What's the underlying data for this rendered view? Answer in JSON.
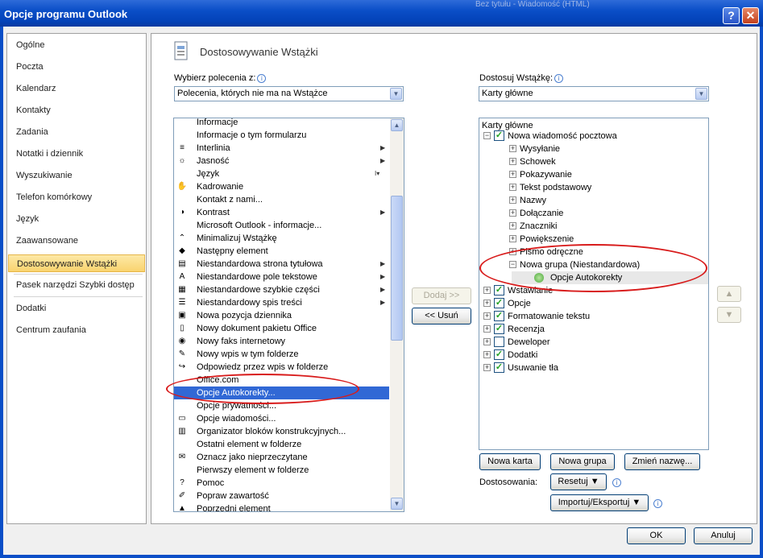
{
  "window": {
    "title": "Opcje programu Outlook",
    "background_title": "Bez tytułu - Wiadomość (HTML)",
    "help_label": "?",
    "close_label": "✕"
  },
  "nav": {
    "items": [
      {
        "label": "Ogólne"
      },
      {
        "label": "Poczta"
      },
      {
        "label": "Kalendarz"
      },
      {
        "label": "Kontakty"
      },
      {
        "label": "Zadania"
      },
      {
        "label": "Notatki i dziennik"
      },
      {
        "label": "Wyszukiwanie"
      },
      {
        "label": "Telefon komórkowy"
      },
      {
        "label": "Język"
      },
      {
        "label": "Zaawansowane"
      },
      {
        "label": "Dostosowywanie Wstążki",
        "selected": true
      },
      {
        "label": "Pasek narzędzi Szybki dostęp"
      },
      {
        "label": "Dodatki"
      },
      {
        "label": "Centrum zaufania"
      }
    ]
  },
  "page": {
    "heading": "Dostosowywanie Wstążki",
    "choose_label": "Wybierz polecenia z:",
    "choose_value": "Polecenia, których nie ma na Wstążce",
    "customize_label": "Dostosuj Wstążkę:",
    "customize_value": "Karty główne",
    "info_glyph": "i"
  },
  "commands": [
    {
      "label": "Informacje",
      "icon": ""
    },
    {
      "label": "Informacje o tym formularzu",
      "icon": ""
    },
    {
      "label": "Interlinia",
      "icon": "line-spacing-icon",
      "glyph": "≡",
      "submenu": true
    },
    {
      "label": "Jasność",
      "icon": "brightness-icon",
      "glyph": "☼",
      "submenu": true
    },
    {
      "label": "Język",
      "icon": "",
      "split": true
    },
    {
      "label": "Kadrowanie",
      "icon": "hand-icon",
      "glyph": "✋"
    },
    {
      "label": "Kontakt z nami...",
      "icon": ""
    },
    {
      "label": "Kontrast",
      "icon": "contrast-icon",
      "glyph": "◑",
      "submenu": true
    },
    {
      "label": "Microsoft Outlook - informacje...",
      "icon": ""
    },
    {
      "label": "Minimalizuj Wstążkę",
      "icon": "minimize-ribbon-icon",
      "glyph": "⌃"
    },
    {
      "label": "Następny element",
      "icon": "next-item-icon",
      "glyph": "◆"
    },
    {
      "label": "Niestandardowa strona tytułowa",
      "icon": "cover-page-icon",
      "glyph": "▤",
      "submenu": true
    },
    {
      "label": "Niestandardowe pole tekstowe",
      "icon": "text-box-icon",
      "glyph": "A",
      "submenu": true
    },
    {
      "label": "Niestandardowe szybkie części",
      "icon": "quick-parts-icon",
      "glyph": "▦",
      "submenu": true
    },
    {
      "label": "Niestandardowy spis treści",
      "icon": "table-of-contents-icon",
      "glyph": "☰",
      "submenu": true
    },
    {
      "label": "Nowa pozycja dziennika",
      "icon": "journal-icon",
      "glyph": "▣"
    },
    {
      "label": "Nowy dokument pakietu Office",
      "icon": "document-icon",
      "glyph": "▯"
    },
    {
      "label": "Nowy faks internetowy",
      "icon": "fax-icon",
      "glyph": "◉"
    },
    {
      "label": "Nowy wpis w tym folderze",
      "icon": "post-icon",
      "glyph": "✎"
    },
    {
      "label": "Odpowiedz przez wpis w folderze",
      "icon": "reply-post-icon",
      "glyph": "↪"
    },
    {
      "label": "Office.com",
      "icon": ""
    },
    {
      "label": "Opcje Autokorekty...",
      "icon": "",
      "selected": true
    },
    {
      "label": "Opcje prywatności...",
      "icon": ""
    },
    {
      "label": "Opcje wiadomości...",
      "icon": "message-options-icon",
      "glyph": "▭"
    },
    {
      "label": "Organizator bloków konstrukcyjnych...",
      "icon": "building-blocks-icon",
      "glyph": "▥"
    },
    {
      "label": "Ostatni element w folderze",
      "icon": ""
    },
    {
      "label": "Oznacz jako nieprzeczytane",
      "icon": "mark-unread-icon",
      "glyph": "✉"
    },
    {
      "label": "Pierwszy element w folderze",
      "icon": ""
    },
    {
      "label": "Pomoc",
      "icon": "help-icon",
      "glyph": "?"
    },
    {
      "label": "Popraw zawartość",
      "icon": "edit-icon",
      "glyph": "✐"
    },
    {
      "label": "Poprzedni element",
      "icon": "previous-item-icon",
      "glyph": "▲"
    }
  ],
  "tree": {
    "header": "Karty główne",
    "nodes": [
      {
        "label": "Nowa wiadomość pocztowa",
        "level": 0,
        "toggle": "−",
        "checked": true
      },
      {
        "label": "Wysyłanie",
        "level": 1,
        "toggle": "+"
      },
      {
        "label": "Schowek",
        "level": 1,
        "toggle": "+"
      },
      {
        "label": "Pokazywanie",
        "level": 1,
        "toggle": "+"
      },
      {
        "label": "Tekst podstawowy",
        "level": 1,
        "toggle": "+"
      },
      {
        "label": "Nazwy",
        "level": 1,
        "toggle": "+"
      },
      {
        "label": "Dołączanie",
        "level": 1,
        "toggle": "+"
      },
      {
        "label": "Znaczniki",
        "level": 1,
        "toggle": "+"
      },
      {
        "label": "Powiększenie",
        "level": 1,
        "toggle": "+"
      },
      {
        "label": "Pismo odręczne",
        "level": 1,
        "toggle": "+"
      },
      {
        "label": "Nowa grupa (Niestandardowa)",
        "level": 1,
        "toggle": "−"
      },
      {
        "label": "Opcje Autokorekty",
        "level": 2,
        "toggle": "",
        "highlight": true
      },
      {
        "label": "Wstawianie",
        "level": 0,
        "toggle": "+",
        "checked": true
      },
      {
        "label": "Opcje",
        "level": 0,
        "toggle": "+",
        "checked": true
      },
      {
        "label": "Formatowanie tekstu",
        "level": 0,
        "toggle": "+",
        "checked": true
      },
      {
        "label": "Recenzja",
        "level": 0,
        "toggle": "+",
        "checked": true
      },
      {
        "label": "Deweloper",
        "level": 0,
        "toggle": "+",
        "checked": false
      },
      {
        "label": "Dodatki",
        "level": 0,
        "toggle": "+",
        "checked": true
      },
      {
        "label": "Usuwanie tła",
        "level": 0,
        "toggle": "+",
        "checked": true
      }
    ]
  },
  "buttons": {
    "add": "Dodaj >>",
    "remove": "<< Usuń",
    "new_tab": "Nowa karta",
    "new_group": "Nowa grupa",
    "rename": "Zmień nazwę...",
    "customizations_label": "Dostosowania:",
    "reset": "Resetuj ▼",
    "import_export": "Importuj/Eksportuj ▼",
    "ok": "OK",
    "cancel": "Anuluj"
  },
  "colors": {
    "selection": "#3168d5",
    "annotation": "#d81b1b",
    "nav_selected": "#f9d36f"
  }
}
